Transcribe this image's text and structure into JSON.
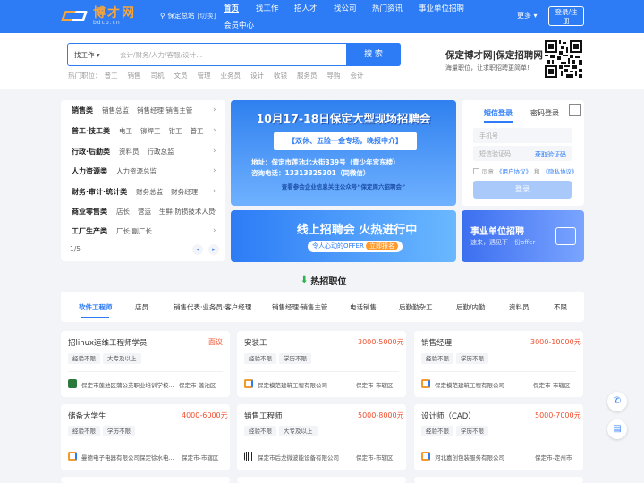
{
  "header": {
    "logo_cn": "博才网",
    "logo_en": "bdcp.cn",
    "city": "保定总站",
    "city_switch": "[切换]",
    "nav": [
      {
        "label": "首页",
        "active": true
      },
      {
        "label": "找工作"
      },
      {
        "label": "招人才"
      },
      {
        "label": "找公司"
      },
      {
        "label": "热门资讯"
      },
      {
        "label": "事业单位招聘"
      },
      {
        "label": "会员中心"
      }
    ],
    "more": "更多",
    "login": "登录/注",
    "register_tail": "册"
  },
  "search": {
    "type": "找工作",
    "placeholder": "会计/财务/人力/客服/设计...",
    "button": "搜 索",
    "hot_label": "热门职位：",
    "hot": [
      "普工",
      "销售",
      "司机",
      "文员",
      "管理",
      "业务员",
      "设计",
      "收银",
      "服务员",
      "导购",
      "会计"
    ]
  },
  "brand": {
    "title": "保定博才网|保定招聘网",
    "subtitle": "海量职位，让求职招聘更简单!"
  },
  "categories": [
    {
      "head": "销售类",
      "subs": [
        "销售总监",
        "销售经理·销售主管"
      ]
    },
    {
      "head": "普工·技工类",
      "subs": [
        "电工",
        "铆焊工",
        "钳工",
        "普工"
      ]
    },
    {
      "head": "行政·后勤类",
      "subs": [
        "资料员",
        "行政总监"
      ]
    },
    {
      "head": "人力资源类",
      "subs": [
        "人力资源总监"
      ]
    },
    {
      "head": "财务·审计·统计类",
      "subs": [
        "财务总监",
        "财务经理"
      ]
    },
    {
      "head": "商业零售类",
      "subs": [
        "店长",
        "营运",
        "生鲜·防损技术人员"
      ]
    },
    {
      "head": "工厂生产类",
      "subs": [
        "厂长·副厂长"
      ]
    }
  ],
  "cat_pager": "1/5",
  "banner1": {
    "title": "10月17-18日保定大型现场招聘会",
    "sub": "【双休、五险一金专场，晚报中介】",
    "addr1": "地址：保定市莲池北大街339号（青少年宫东楼）",
    "addr2": "咨询电话：13313325301（同微信）",
    "foot": "查看参会企业信息关注公众号“保定周六招聘会”"
  },
  "banner2": {
    "title": "线上招聘会 火热进行中",
    "tag": "令人心动的OFFER",
    "tag_btn": "立即报名"
  },
  "banner3": {
    "title": "事业单位招聘",
    "subtitle": "速来，遇见下一份offer~"
  },
  "login": {
    "tab_sms": "短信登录",
    "tab_pwd": "密码登录",
    "phone_ph": "手机号",
    "code_ph": "短信验证码",
    "get_code": "获取验证码",
    "agree": "同意",
    "agree_user": "《用户协议》",
    "agree_and": "和",
    "agree_privacy": "《隐私协议》",
    "button": "登录"
  },
  "hot_jobs": {
    "title": "热招职位",
    "tabs": [
      "软件工程师",
      "店员",
      "销售代表·业务员·客户经理",
      "销售经理·销售主管",
      "电话销售",
      "后勤勤杂工",
      "后勤/内勤",
      "资料员",
      "不限"
    ]
  },
  "jobs": [
    {
      "title": "招linux运维工程师学员",
      "salary": "面议",
      "tags": [
        "经验不限",
        "大专及以上"
      ],
      "company": "保定市莲池区蒲公英职业培训学校...",
      "location": "保定市-莲池区"
    },
    {
      "title": "安装工",
      "salary": "3000-5000元",
      "tags": [
        "经验不限",
        "学历不限"
      ],
      "company": "保定模范建筑工程有限公司",
      "location": "保定市-市辖区"
    },
    {
      "title": "销售经理",
      "salary": "3000-10000元",
      "tags": [
        "经验不限",
        "学历不限"
      ],
      "company": "保定模范建筑工程有限公司",
      "location": "保定市-市辖区"
    },
    {
      "title": "储备大学生",
      "salary": "4000-6000元",
      "tags": [
        "经验不限",
        "学历不限"
      ],
      "company": "曼德电子电器有限公司保定徐水电...",
      "location": "保定市-市辖区"
    },
    {
      "title": "销售工程师",
      "salary": "5000-8000元",
      "tags": [
        "经验不限",
        "大专及以上"
      ],
      "company": "保定市后龙微波能设备有限公司",
      "location": "保定市-市辖区"
    },
    {
      "title": "设计师（CAD）",
      "salary": "5000-7000元",
      "tags": [
        "经验不限",
        "学历不限"
      ],
      "company": "河北嘉创包装服务有限公司",
      "location": "保定市-定州市"
    }
  ],
  "colors": {
    "primary": "#2d7cf6",
    "salary": "#f0502f",
    "logo_orange": "#f7a43a"
  }
}
